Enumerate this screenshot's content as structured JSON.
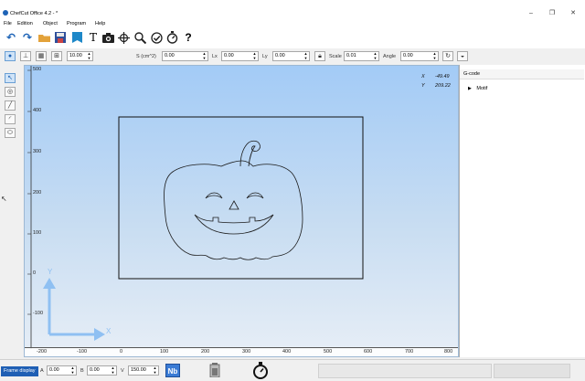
{
  "window": {
    "title": "ChefCut Office 4.2 - *",
    "minimize": "–",
    "maximize": "❐",
    "close": "✕"
  },
  "menu": [
    "File",
    "Edition",
    "Object",
    "Program",
    "Help"
  ],
  "toolbar2": {
    "zoom_value": "10.00",
    "surface_label": "S (cm^2)",
    "surface_value": "0.00",
    "lx_label": "Lx",
    "lx_value": "0.00",
    "ly_label": "Ly",
    "ly_value": "0.00",
    "scale_label": "Scale",
    "scale_value": "0.01",
    "angle_label": "Angle",
    "angle_value": "0.00"
  },
  "canvas": {
    "y_ticks": [
      "500",
      "400",
      "300",
      "200",
      "100",
      "0",
      "-100"
    ],
    "x_ticks": [
      "-200",
      "-100",
      "0",
      "100",
      "200",
      "300",
      "400",
      "500",
      "600",
      "700",
      "800"
    ],
    "coord_x_label": "X",
    "coord_x_value": "-49.49",
    "coord_y_label": "Y",
    "coord_y_value": "209.22",
    "axis_x_label": "X",
    "axis_y_label": "Y"
  },
  "panel": {
    "title": "G-code",
    "item": "Motif"
  },
  "status": {
    "frame_display": "Frame display",
    "a_label": "A",
    "a_value": "0.00",
    "b_label": "B",
    "b_value": "0.00",
    "v_label": "V",
    "v_value": "150.00",
    "nb_label": "Nb"
  },
  "colors": {
    "accent": "#1d63b6",
    "canvas_top": "#a3cbf6",
    "canvas_bottom": "#e7eef6"
  }
}
